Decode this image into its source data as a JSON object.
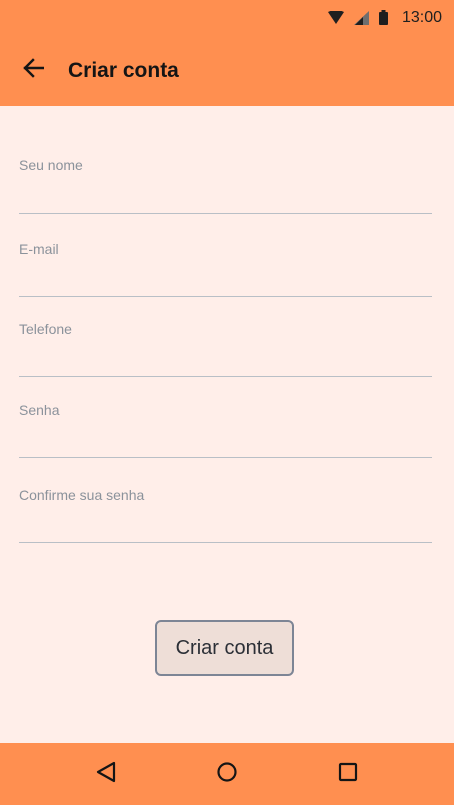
{
  "status_bar": {
    "time": "13:00",
    "icons": [
      "wifi-icon",
      "signal-icon",
      "battery-icon"
    ]
  },
  "app_bar": {
    "title": "Criar conta",
    "back_icon": "arrow-back-icon"
  },
  "form": {
    "fields": [
      {
        "label": "Seu nome",
        "value": ""
      },
      {
        "label": "E-mail",
        "value": ""
      },
      {
        "label": "Telefone",
        "value": ""
      },
      {
        "label": "Senha",
        "value": ""
      },
      {
        "label": "Confirme sua senha",
        "value": ""
      }
    ],
    "submit_label": "Criar conta"
  },
  "nav_bar": {
    "icons": [
      "nav-back-icon",
      "nav-home-icon",
      "nav-recents-icon"
    ]
  },
  "colors": {
    "accent": "#ff8f50",
    "background": "#ffeee9",
    "button_bg": "#eeded7",
    "button_border": "#7d8595",
    "label": "#8b929b",
    "underline": "#b9bfc6"
  }
}
